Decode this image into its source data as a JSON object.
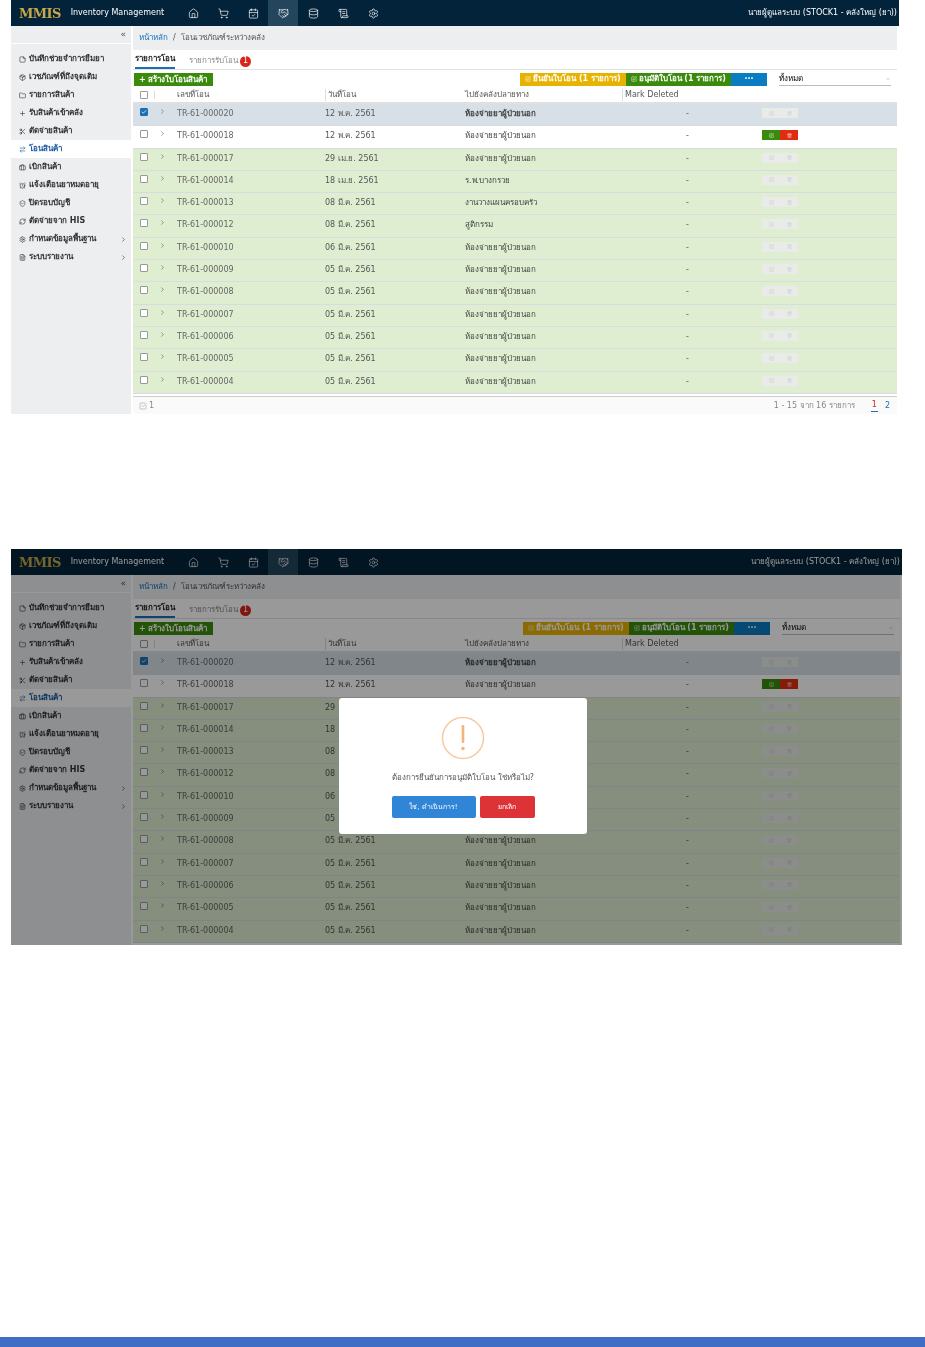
{
  "screens": [
    {
      "logo": "MMIS",
      "app_title": "Inventory Management",
      "nav": [
        {
          "kind": "home",
          "selected": false
        },
        {
          "kind": "cart",
          "selected": false
        },
        {
          "kind": "calendar",
          "selected": false
        },
        {
          "kind": "handshake",
          "selected": true
        },
        {
          "kind": "database",
          "selected": false
        },
        {
          "kind": "scroll",
          "selected": false
        },
        {
          "kind": "settings",
          "selected": false
        }
      ],
      "user": "นายผู้ดูแลระบบ (STOCK1 - คลังใหญ่ (ยา))",
      "sidebar": {
        "collapse": "«",
        "items": [
          {
            "label": "บันทึกช่วยจำการยืมยา",
            "selected": false,
            "expandable": false
          },
          {
            "label": "เวชภัณฑ์ที่ถึงจุดเติม",
            "selected": false,
            "expandable": false
          },
          {
            "label": "รายการสินค้า",
            "selected": false,
            "expandable": false
          },
          {
            "label": "รับสินค้าเข้าคลัง",
            "selected": false,
            "expandable": false
          },
          {
            "label": "ตัดจ่ายสินค้า",
            "selected": false,
            "expandable": false
          },
          {
            "label": "โอนสินค้า",
            "selected": true,
            "expandable": false
          },
          {
            "label": "เบิกสินค้า",
            "selected": false,
            "expandable": false
          },
          {
            "label": "แจ้งเตือนยาหมดอายุ",
            "selected": false,
            "expandable": false
          },
          {
            "label": "ปิดรอบบัญชี",
            "selected": false,
            "expandable": false
          },
          {
            "label": "ตัดจ่ายจาก HIS",
            "selected": false,
            "expandable": false
          },
          {
            "label": "กำหนดข้อมูลพื้นฐาน",
            "selected": false,
            "expandable": true
          },
          {
            "label": "ระบบรายงาน",
            "selected": false,
            "expandable": true
          }
        ]
      },
      "breadcrumb": [
        "หน้าหลัก",
        "/",
        "โอนเวชภัณฑ์ระหว่างคลัง"
      ],
      "tabs": [
        {
          "label": "รายการโอน",
          "selected": true
        },
        {
          "label": "รายการรับโอน",
          "selected": false,
          "badge": "1"
        }
      ],
      "create_button": "+ สร้างใบโอนสินค้า",
      "actions": [
        {
          "kind": "confirm",
          "label": "ยืนยันใบโอน (1 รายการ)"
        },
        {
          "kind": "approve",
          "label": "อนุมัติใบโอน (1 รายการ)"
        },
        {
          "kind": "more",
          "label": "···"
        }
      ],
      "filter": {
        "value": "ทั้งหมด"
      },
      "columns": [
        "เลขที่โอน",
        "วันที่โอน",
        "ไปยังคลังปลายทาง",
        "Mark Deleted"
      ],
      "header_checked": false,
      "rows": [
        {
          "number": "TR-61-000020",
          "date": "12 พ.ค. 2561",
          "destination": "ห้องจ่ายยาผู้ป่วยนอก",
          "mark": "-",
          "selected": true,
          "approved": false,
          "editable": false
        },
        {
          "number": "TR-61-000018",
          "date": "12 พ.ค. 2561",
          "destination": "ห้องจ่ายยาผู้ป่วยนอก",
          "mark": "-",
          "selected": false,
          "approved": false,
          "editable": true
        },
        {
          "number": "TR-61-000017",
          "date": "29 เม.ย. 2561",
          "destination": "ห้องจ่ายยาผู้ป่วยนอก",
          "mark": "-",
          "selected": false,
          "approved": true,
          "editable": false
        },
        {
          "number": "TR-61-000014",
          "date": "18 เม.ย. 2561",
          "destination": "ร.พ.บางกรวย",
          "mark": "-",
          "selected": false,
          "approved": true,
          "editable": false
        },
        {
          "number": "TR-61-000013",
          "date": "08 มี.ค. 2561",
          "destination": "งานวางแผนครอบครัว",
          "mark": "-",
          "selected": false,
          "approved": true,
          "editable": false
        },
        {
          "number": "TR-61-000012",
          "date": "08 มี.ค. 2561",
          "destination": "สูติกรรม",
          "mark": "-",
          "selected": false,
          "approved": true,
          "editable": false
        },
        {
          "number": "TR-61-000010",
          "date": "06 มี.ค. 2561",
          "destination": "ห้องจ่ายยาผู้ป่วยนอก",
          "mark": "-",
          "selected": false,
          "approved": true,
          "editable": false
        },
        {
          "number": "TR-61-000009",
          "date": "05 มี.ค. 2561",
          "destination": "ห้องจ่ายยาผู้ป่วยนอก",
          "mark": "-",
          "selected": false,
          "approved": true,
          "editable": false
        },
        {
          "number": "TR-61-000008",
          "date": "05 มี.ค. 2561",
          "destination": "ห้องจ่ายยาผู้ป่วยนอก",
          "mark": "-",
          "selected": false,
          "approved": true,
          "editable": false
        },
        {
          "number": "TR-61-000007",
          "date": "05 มี.ค. 2561",
          "destination": "ห้องจ่ายยาผู้ป่วยนอก",
          "mark": "-",
          "selected": false,
          "approved": true,
          "editable": false
        },
        {
          "number": "TR-61-000006",
          "date": "05 มี.ค. 2561",
          "destination": "ห้องจ่ายยาผู้ป่วยนอก",
          "mark": "-",
          "selected": false,
          "approved": true,
          "editable": false
        },
        {
          "number": "TR-61-000005",
          "date": "05 มี.ค. 2561",
          "destination": "ห้องจ่ายยาผู้ป่วยนอก",
          "mark": "-",
          "selected": false,
          "approved": true,
          "editable": false
        },
        {
          "number": "TR-61-000004",
          "date": "05 มี.ค. 2561",
          "destination": "ห้องจ่ายยาผู้ป่วยนอก",
          "mark": "-",
          "selected": false,
          "approved": true,
          "editable": false
        }
      ],
      "footer": {
        "selected_count": "1",
        "range": "1 - 15 จาก 16 รายการ",
        "pages": [
          {
            "label": "1",
            "selected": true
          },
          {
            "label": "2",
            "selected": false
          }
        ]
      }
    },
    {
      "logo": "MMIS",
      "app_title": "Inventory Management",
      "nav": [
        {
          "kind": "home",
          "selected": false
        },
        {
          "kind": "cart",
          "selected": false
        },
        {
          "kind": "calendar",
          "selected": false
        },
        {
          "kind": "handshake",
          "selected": true
        },
        {
          "kind": "database",
          "selected": false
        },
        {
          "kind": "scroll",
          "selected": false
        },
        {
          "kind": "settings",
          "selected": false
        }
      ],
      "user": "นายผู้ดูแลระบบ (STOCK1 - คลังใหญ่ (ยา))",
      "sidebar": {
        "collapse": "«",
        "items": [
          {
            "label": "บันทึกช่วยจำการยืมยา",
            "selected": false,
            "expandable": false
          },
          {
            "label": "เวชภัณฑ์ที่ถึงจุดเติม",
            "selected": false,
            "expandable": false
          },
          {
            "label": "รายการสินค้า",
            "selected": false,
            "expandable": false
          },
          {
            "label": "รับสินค้าเข้าคลัง",
            "selected": false,
            "expandable": false
          },
          {
            "label": "ตัดจ่ายสินค้า",
            "selected": false,
            "expandable": false
          },
          {
            "label": "โอนสินค้า",
            "selected": true,
            "expandable": false
          },
          {
            "label": "เบิกสินค้า",
            "selected": false,
            "expandable": false
          },
          {
            "label": "แจ้งเตือนยาหมดอายุ",
            "selected": false,
            "expandable": false
          },
          {
            "label": "ปิดรอบบัญชี",
            "selected": false,
            "expandable": false
          },
          {
            "label": "ตัดจ่ายจาก HIS",
            "selected": false,
            "expandable": false
          },
          {
            "label": "กำหนดข้อมูลพื้นฐาน",
            "selected": false,
            "expandable": true
          },
          {
            "label": "ระบบรายงาน",
            "selected": false,
            "expandable": true
          }
        ]
      },
      "breadcrumb": [
        "หน้าหลัก",
        "/",
        "โอนเวชภัณฑ์ระหว่างคลัง"
      ],
      "tabs": [
        {
          "label": "รายการโอน",
          "selected": true
        },
        {
          "label": "รายการรับโอน",
          "selected": false,
          "badge": "1"
        }
      ],
      "create_button": "+ สร้างใบโอนสินค้า",
      "actions": [
        {
          "kind": "confirm",
          "label": "ยืนยันใบโอน (1 รายการ)"
        },
        {
          "kind": "approve",
          "label": "อนุมัติใบโอน (1 รายการ)"
        },
        {
          "kind": "more",
          "label": "···"
        }
      ],
      "filter": {
        "value": "ทั้งหมด"
      },
      "columns": [
        "เลขที่โอน",
        "วันที่โอน",
        "ไปยังคลังปลายทาง",
        "Mark Deleted"
      ],
      "header_checked": false,
      "rows": [
        {
          "number": "TR-61-000020",
          "date": "12 พ.ค. 2561",
          "destination": "ห้องจ่ายยาผู้ป่วยนอก",
          "mark": "-",
          "selected": true,
          "approved": false,
          "editable": false
        },
        {
          "number": "TR-61-000018",
          "date": "12 พ.ค. 2561",
          "destination": "ห้องจ่ายยาผู้ป่วยนอก",
          "mark": "-",
          "selected": false,
          "approved": false,
          "editable": true
        },
        {
          "number": "TR-61-000017",
          "date": "29",
          "mark": "-",
          "selected": false,
          "approved": true,
          "editable": false
        },
        {
          "number": "TR-61-000014",
          "date": "18",
          "mark": "-",
          "selected": false,
          "approved": true,
          "editable": false
        },
        {
          "number": "TR-61-000013",
          "date": "08",
          "mark": "-",
          "selected": false,
          "approved": true,
          "editable": false
        },
        {
          "number": "TR-61-000012",
          "date": "08",
          "mark": "-",
          "selected": false,
          "approved": true,
          "editable": false
        },
        {
          "number": "TR-61-000010",
          "date": "06",
          "mark": "-",
          "selected": false,
          "approved": true,
          "editable": false
        },
        {
          "number": "TR-61-000009",
          "date": "05",
          "mark": "-",
          "selected": false,
          "approved": true,
          "editable": false
        },
        {
          "number": "TR-61-000008",
          "date": "05 มี.ค. 2561",
          "destination": "ห้องจ่ายยาผู้ป่วยนอก",
          "mark": "-",
          "selected": false,
          "approved": true,
          "editable": false
        },
        {
          "number": "TR-61-000007",
          "date": "05 มี.ค. 2561",
          "destination": "ห้องจ่ายยาผู้ป่วยนอก",
          "mark": "-",
          "selected": false,
          "approved": true,
          "editable": false
        },
        {
          "number": "TR-61-000006",
          "date": "05 มี.ค. 2561",
          "destination": "ห้องจ่ายยาผู้ป่วยนอก",
          "mark": "-",
          "selected": false,
          "approved": true,
          "editable": false
        },
        {
          "number": "TR-61-000005",
          "date": "05 มี.ค. 2561",
          "destination": "ห้องจ่ายยาผู้ป่วยนอก",
          "mark": "-",
          "selected": false,
          "approved": true,
          "editable": false
        },
        {
          "number": "TR-61-000004",
          "date": "05 มี.ค. 2561",
          "destination": "ห้องจ่ายยาผู้ป่วยนอก",
          "mark": "-",
          "selected": false,
          "approved": true,
          "editable": false
        }
      ],
      "dialog": {
        "message": "ต้องการยืนยันการอนุมัติใบโอน ใช่หรือไม่?",
        "confirm": "ใช่, ดำเนินการ!",
        "cancel": "ยกเลิก"
      }
    }
  ]
}
